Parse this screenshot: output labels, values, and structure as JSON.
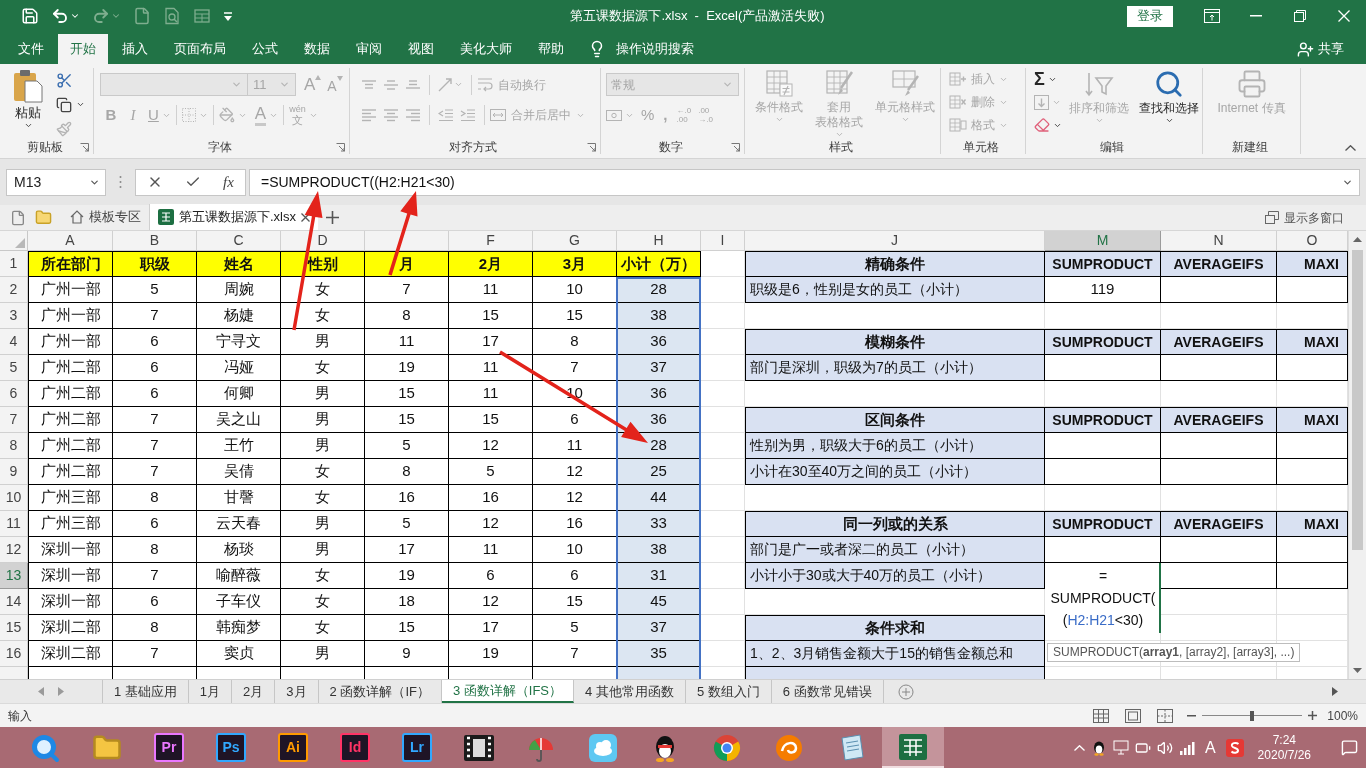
{
  "title_bar": {
    "quick_access": [
      {
        "kind": "save",
        "disabled": false
      },
      {
        "kind": "undo",
        "disabled": false
      },
      {
        "kind": "redo",
        "disabled": true
      },
      {
        "kind": "new",
        "disabled": true
      },
      {
        "kind": "preview",
        "disabled": true
      },
      {
        "kind": "form",
        "disabled": true
      },
      {
        "kind": "customize",
        "disabled": false
      }
    ],
    "title": "第五课数据源下.xlsx  -  Excel(产品激活失败)",
    "sign_in": "登录"
  },
  "ribbon_tabs": [
    {
      "label": "文件",
      "selected": false
    },
    {
      "label": "开始",
      "selected": true
    },
    {
      "label": "插入",
      "selected": false
    },
    {
      "label": "页面布局",
      "selected": false
    },
    {
      "label": "公式",
      "selected": false
    },
    {
      "label": "数据",
      "selected": false
    },
    {
      "label": "审阅",
      "selected": false
    },
    {
      "label": "视图",
      "selected": false
    },
    {
      "label": "美化大师",
      "selected": false
    },
    {
      "label": "帮助",
      "selected": false
    }
  ],
  "tell_me": "操作说明搜索",
  "share": "共享",
  "ribbon": {
    "clipboard": {
      "label": "剪贴板",
      "paste": {
        "label": "粘贴",
        "disabled": false
      },
      "cut": {
        "disabled": false
      },
      "copy": {
        "disabled": false
      },
      "format_painter": {
        "disabled": true
      }
    },
    "font": {
      "label": "字体",
      "disabled": true,
      "size": "11",
      "grow": "A",
      "shrink": "A",
      "bold": "B",
      "italic": "I",
      "underline": "U",
      "font_color": "A",
      "phonetic": [
        "wén",
        "文"
      ]
    },
    "alignment": {
      "label": "对齐方式",
      "disabled": true,
      "wrap_text": "自动换行",
      "merge": "合并后居中"
    },
    "number": {
      "label": "数字",
      "disabled": true,
      "format": "常规",
      "percent": "%",
      "comma": ",",
      "increase_decimal": [
        "←.0",
        ".00"
      ],
      "decrease_decimal": [
        ".00",
        "→.0"
      ]
    },
    "styles": {
      "label": "样式",
      "disabled": true,
      "commands": [
        [
          "条件格式"
        ],
        [
          "套用",
          "表格格式"
        ],
        [
          "单元格样式"
        ]
      ]
    },
    "cells": {
      "label": "单元格",
      "disabled": true,
      "commands": [
        "插入",
        "删除",
        "格式"
      ]
    },
    "editing": {
      "label": "编辑",
      "autosum": {
        "symbol": "Σ",
        "disabled": false
      },
      "fill": {
        "disabled": true
      },
      "clear": {
        "disabled": false
      },
      "sort": {
        "label": "排序和筛选",
        "disabled": true
      },
      "find": {
        "label": "查找和选择",
        "disabled": false
      }
    },
    "new_group": {
      "label": "新建组",
      "fax": {
        "label": "Internet 传真",
        "disabled": true
      }
    }
  },
  "formula_bar": {
    "name_box": "M13",
    "function_button": "fx",
    "formula": "=SUMPRODUCT((H2:H21<30)"
  },
  "document_tabs": [
    {
      "kind": "home",
      "label": "模板专区",
      "selected": false
    },
    {
      "kind": "workbook",
      "label": "第五课数据源下.xlsx",
      "selected": true
    }
  ],
  "multi_window": "显示多窗口",
  "sheet": {
    "columns": [
      {
        "letter": "A",
        "selected": false
      },
      {
        "letter": "B",
        "selected": false
      },
      {
        "letter": "C",
        "selected": false
      },
      {
        "letter": "D",
        "selected": false
      },
      {
        "selected": false
      },
      {
        "letter": "F",
        "selected": false
      },
      {
        "letter": "G",
        "selected": false
      },
      {
        "letter": "H",
        "selected": false
      },
      {
        "letter": "I",
        "selected": false
      },
      {
        "letter": "J",
        "selected": false
      },
      {
        "letter": "M",
        "selected": true
      },
      {
        "letter": "N",
        "selected": false
      },
      {
        "letter": "O",
        "selected": false
      }
    ],
    "row_headers": [
      {
        "number": "1",
        "selected": false
      },
      {
        "number": "2",
        "selected": false
      },
      {
        "number": "3",
        "selected": false
      },
      {
        "number": "4",
        "selected": false
      },
      {
        "number": "5",
        "selected": false
      },
      {
        "number": "6",
        "selected": false
      },
      {
        "number": "7",
        "selected": false
      },
      {
        "number": "8",
        "selected": false
      },
      {
        "number": "9",
        "selected": false
      },
      {
        "number": "10",
        "selected": false
      },
      {
        "number": "11",
        "selected": false
      },
      {
        "number": "12",
        "selected": false
      },
      {
        "number": "13",
        "selected": true
      },
      {
        "number": "14",
        "selected": false
      },
      {
        "number": "15",
        "selected": false
      },
      {
        "number": "16",
        "selected": false
      }
    ],
    "table": {
      "header": [
        {
          "text": "所在部门",
          "highlighted": false
        },
        {
          "text": "职级",
          "highlighted": false
        },
        {
          "text": "姓名",
          "highlighted": false
        },
        {
          "text": "性别",
          "highlighted": false
        },
        {
          "text": "月",
          "highlighted": false
        },
        {
          "text": "2月",
          "highlighted": false
        },
        {
          "text": "3月",
          "highlighted": false
        },
        {
          "text": "小计（万）",
          "highlighted": true
        }
      ],
      "rows": [
        [
          "广州一部",
          "5",
          "周婉",
          "女",
          "7",
          "11",
          "10",
          "28"
        ],
        [
          "广州一部",
          "7",
          "杨婕",
          "女",
          "8",
          "15",
          "15",
          "38"
        ],
        [
          "广州一部",
          "6",
          "宁寻文",
          "男",
          "11",
          "17",
          "8",
          "36"
        ],
        [
          "广州二部",
          "6",
          "冯娅",
          "女",
          "19",
          "11",
          "7",
          "37"
        ],
        [
          "广州二部",
          "6",
          "何卿",
          "男",
          "15",
          "11",
          "10",
          "36"
        ],
        [
          "广州二部",
          "7",
          "吴之山",
          "男",
          "15",
          "15",
          "6",
          "36"
        ],
        [
          "广州二部",
          "7",
          "王竹",
          "男",
          "5",
          "12",
          "11",
          "28"
        ],
        [
          "广州二部",
          "7",
          "吴倩",
          "女",
          "8",
          "5",
          "12",
          "25"
        ],
        [
          "广州三部",
          "8",
          "甘謦",
          "女",
          "16",
          "16",
          "12",
          "44"
        ],
        [
          "广州三部",
          "6",
          "云天春",
          "男",
          "5",
          "12",
          "16",
          "33"
        ],
        [
          "深圳一部",
          "8",
          "杨琰",
          "男",
          "17",
          "11",
          "10",
          "38"
        ],
        [
          "深圳一部",
          "7",
          "喻醉薇",
          "女",
          "19",
          "6",
          "6",
          "31"
        ],
        [
          "深圳一部",
          "6",
          "子车仪",
          "女",
          "18",
          "12",
          "15",
          "45"
        ],
        [
          "深圳二部",
          "8",
          "韩痴梦",
          "女",
          "15",
          "17",
          "5",
          "37"
        ],
        [
          "深圳二部",
          "7",
          "窦贞",
          "男",
          "9",
          "19",
          "7",
          "35"
        ]
      ]
    },
    "side_rows": [
      {
        "kind": "title",
        "text": "精确条件",
        "m": "SUMPRODUCT",
        "n": "AVERAGEIFS",
        "o": "MAXI"
      },
      {
        "kind": "item",
        "text": "职级是6，性别是女的员工（小计）",
        "m": "119"
      },
      {
        "kind": "blank"
      },
      {
        "kind": "title",
        "text": "模糊条件",
        "m": "SUMPRODUCT",
        "n": "AVERAGEIFS",
        "o": "MAXI"
      },
      {
        "kind": "item",
        "text": "部门是深圳，职级为7的员工（小计）"
      },
      {
        "kind": "blank"
      },
      {
        "kind": "title",
        "text": "区间条件",
        "m": "SUMPRODUCT",
        "n": "AVERAGEIFS",
        "o": "MAXI"
      },
      {
        "kind": "item",
        "text": "性别为男，职级大于6的员工（小计）"
      },
      {
        "kind": "item",
        "text": "小计在30至40万之间的员工（小计）"
      },
      {
        "kind": "blank"
      },
      {
        "kind": "title",
        "text": "同一列或的关系",
        "m": "SUMPRODUCT",
        "n": "AVERAGEIFS",
        "o": "MAXI"
      },
      {
        "kind": "item",
        "text": "部门是广一或者深二的员工（小计）"
      },
      {
        "kind": "item",
        "text": "小计小于30或大于40万的员工（小计）",
        "editor": {
          "lines": [
            [
              {
                "text": "=",
                "kind": "plain"
              }
            ],
            [
              {
                "text": "SUMPRODUCT(",
                "kind": "plain"
              }
            ],
            [
              {
                "text": "(",
                "kind": "plain"
              },
              {
                "text": "H2:H21",
                "kind": "reference"
              },
              {
                "text": "<30)",
                "kind": "plain"
              }
            ]
          ],
          "tooltip": "SUMPRODUCT(**array1**, [array2], [array3], ...)"
        }
      },
      {
        "kind": "blank"
      },
      {
        "kind": "section",
        "text": "条件求和"
      },
      {
        "kind": "note",
        "text": "1、2、3月销售金额大于15的销售金额总和"
      }
    ]
  },
  "sheet_tabs": [
    {
      "label": "1 基础应用",
      "selected": false
    },
    {
      "label": "1月",
      "selected": false
    },
    {
      "label": "2月",
      "selected": false
    },
    {
      "label": "3月",
      "selected": false
    },
    {
      "label": "2 函数详解（IF）",
      "selected": false
    },
    {
      "label": "3 函数详解（IFS）",
      "selected": true
    },
    {
      "label": "4 其他常用函数",
      "selected": false
    },
    {
      "label": "5 数组入门",
      "selected": false
    },
    {
      "label": "6 函数常见错误",
      "selected": false
    }
  ],
  "status_bar": {
    "mode": "输入",
    "zoom_slider": {
      "level": 0.5
    },
    "zoom": "100%"
  },
  "taskbar": {
    "apps": [
      {
        "kind": "ring",
        "active": false
      },
      {
        "kind": "explorer",
        "active": false
      },
      {
        "kind": "tile",
        "label": "Pr",
        "color": "#ea77ff",
        "active": false
      },
      {
        "kind": "tile",
        "label": "Ps",
        "color": "#31a8ff",
        "active": false
      },
      {
        "kind": "tile",
        "label": "Ai",
        "color": "#ff9a00",
        "active": false
      },
      {
        "kind": "tile",
        "label": "Id",
        "color": "#ff3366",
        "active": false
      },
      {
        "kind": "tile",
        "label": "Lr",
        "color": "#31a8ff",
        "active": false
      },
      {
        "kind": "film",
        "active": false
      },
      {
        "kind": "umbrella",
        "active": false
      },
      {
        "kind": "cloud",
        "active": false
      },
      {
        "kind": "penguin",
        "active": false
      },
      {
        "kind": "round_logo",
        "active": false
      },
      {
        "kind": "swirl",
        "active": false
      },
      {
        "kind": "notepad",
        "active": false
      },
      {
        "kind": "spreadsheet",
        "active": true
      }
    ],
    "ime": "A",
    "time": "7:24",
    "date": "2020/7/26"
  }
}
